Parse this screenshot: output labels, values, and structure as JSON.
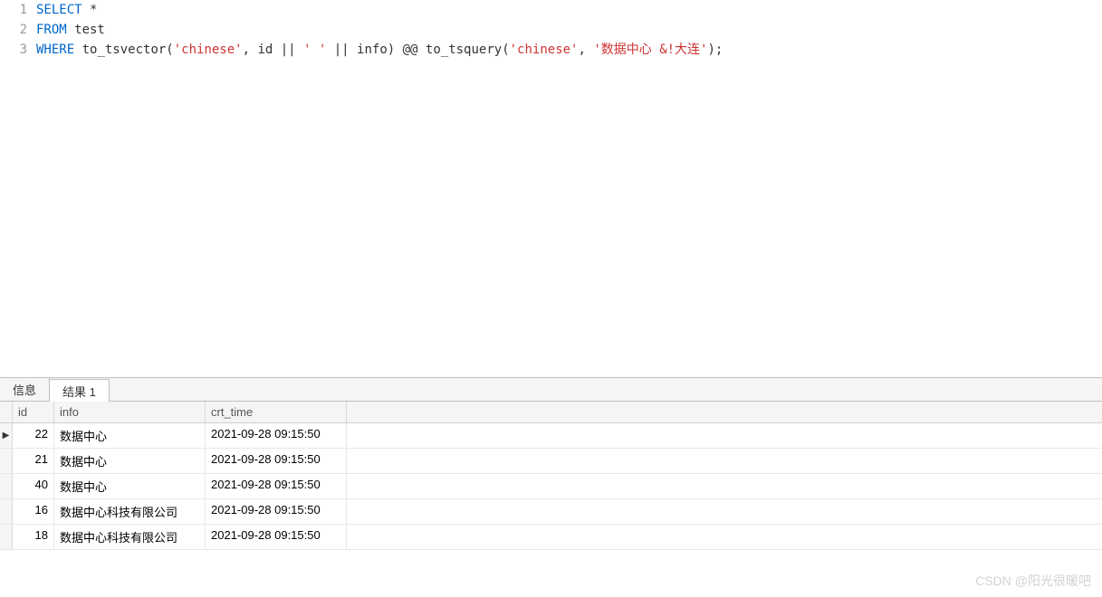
{
  "editor": {
    "lines": [
      {
        "num": "1",
        "tokens": [
          {
            "t": "SELECT",
            "c": "kw"
          },
          {
            "t": " *",
            "c": ""
          }
        ]
      },
      {
        "num": "2",
        "tokens": [
          {
            "t": "FROM",
            "c": "kw"
          },
          {
            "t": " test",
            "c": ""
          }
        ]
      },
      {
        "num": "3",
        "tokens": [
          {
            "t": "WHERE",
            "c": "kw"
          },
          {
            "t": " to_tsvector(",
            "c": ""
          },
          {
            "t": "'chinese'",
            "c": "str"
          },
          {
            "t": ", id || ",
            "c": ""
          },
          {
            "t": "' '",
            "c": "str"
          },
          {
            "t": " || info) @@ to_tsquery(",
            "c": ""
          },
          {
            "t": "'chinese'",
            "c": "str"
          },
          {
            "t": ", ",
            "c": ""
          },
          {
            "t": "'数据中心 &!大连'",
            "c": "str"
          },
          {
            "t": ");",
            "c": ""
          }
        ]
      }
    ]
  },
  "tabs": {
    "info_label": "信息",
    "result_label": "结果 1"
  },
  "grid": {
    "headers": {
      "id": "id",
      "info": "info",
      "crt_time": "crt_time"
    },
    "rows": [
      {
        "selected": true,
        "id": "22",
        "info": "数据中心",
        "crt_time": "2021-09-28 09:15:50"
      },
      {
        "selected": false,
        "id": "21",
        "info": "数据中心",
        "crt_time": "2021-09-28 09:15:50"
      },
      {
        "selected": false,
        "id": "40",
        "info": "数据中心",
        "crt_time": "2021-09-28 09:15:50"
      },
      {
        "selected": false,
        "id": "16",
        "info": "数据中心科技有限公司",
        "crt_time": "2021-09-28 09:15:50"
      },
      {
        "selected": false,
        "id": "18",
        "info": "数据中心科技有限公司",
        "crt_time": "2021-09-28 09:15:50"
      }
    ]
  },
  "watermark": "CSDN @阳光很暖吧"
}
